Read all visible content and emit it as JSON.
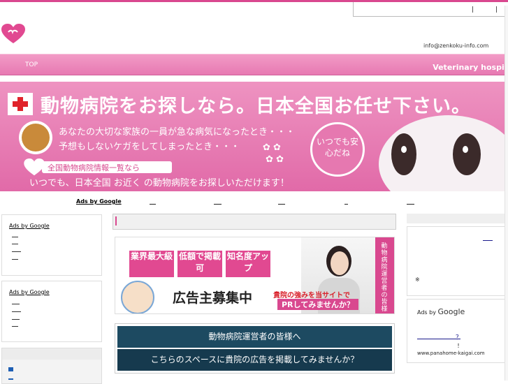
{
  "header": {
    "email": "info@zenkoku-info.com"
  },
  "nav": {
    "top_label": "TOP",
    "right_label": "Veterinary hospit"
  },
  "banner": {
    "title": "動物病院をお探しなら。日本全国お任せ下さい。",
    "line1": "あなたの大切な家族の一員が急な病気になったとき・・・",
    "line2": "予想もしないケガをしてしまったとき・・・",
    "pill": "全国動物病院情報一覧なら",
    "line3": "いつでも、日本全国 お近く の動物病院をお探しいただけます！",
    "bubble": "いつでも安心だね"
  },
  "ads_row": {
    "label": "Ads by Google"
  },
  "left": {
    "box1_label": "Ads by Google",
    "box2_label": "Ads by Google"
  },
  "ad1": {
    "block1": "業界最大級",
    "block2": "低額で掲載可",
    "block3": "知名度アップ",
    "headline": "広告主募集中",
    "red_text": "貴院の強みを当サイトで",
    "pr_text": "PRしてみませんか？",
    "vertical": "動物病院運営者の皆様へ"
  },
  "ad2": {
    "line1": "動物病院運営者の皆様へ",
    "line2": "こちらのスペースに貴院の広告を掲載してみませんか？"
  },
  "right": {
    "ads_prefix": "Ads by",
    "ads_brand": "Google",
    "question": "？",
    "bang": "！",
    "url": "www.panahome-kaigai.com",
    "star": "※"
  },
  "colors": {
    "brand_pink": "#d9488f",
    "nav_pink": "#ee8dbf",
    "banner_pink": "#e678b0",
    "ad_navy": "#1d4a61"
  }
}
